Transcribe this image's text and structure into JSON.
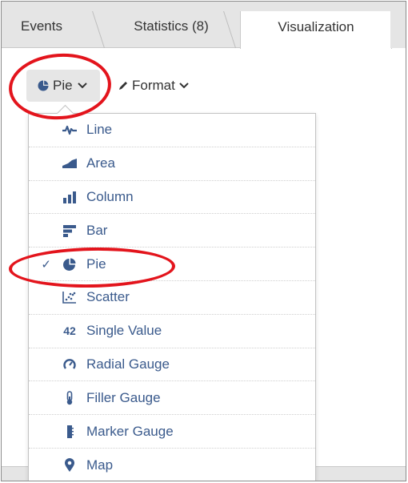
{
  "tabs": [
    {
      "label": "Events"
    },
    {
      "label": "Statistics (8)"
    },
    {
      "label": "Visualization",
      "active": true
    }
  ],
  "toolbar": {
    "chart_type_label": "Pie",
    "format_label": "Format"
  },
  "menu": {
    "items": [
      {
        "label": "Line",
        "icon": "line-chart-icon"
      },
      {
        "label": "Area",
        "icon": "area-chart-icon"
      },
      {
        "label": "Column",
        "icon": "column-chart-icon"
      },
      {
        "label": "Bar",
        "icon": "bar-chart-icon"
      },
      {
        "label": "Pie",
        "icon": "pie-chart-icon",
        "selected": true
      },
      {
        "label": "Scatter",
        "icon": "scatter-chart-icon"
      },
      {
        "label": "Single Value",
        "icon": "single-value-icon",
        "icon_text": "42"
      },
      {
        "label": "Radial Gauge",
        "icon": "radial-gauge-icon"
      },
      {
        "label": "Filler Gauge",
        "icon": "filler-gauge-icon"
      },
      {
        "label": "Marker Gauge",
        "icon": "marker-gauge-icon"
      },
      {
        "label": "Map",
        "icon": "map-marker-icon"
      }
    ],
    "check_glyph": "✓"
  },
  "colors": {
    "accent": "#3a5a8c",
    "highlight": "#e3141c"
  }
}
